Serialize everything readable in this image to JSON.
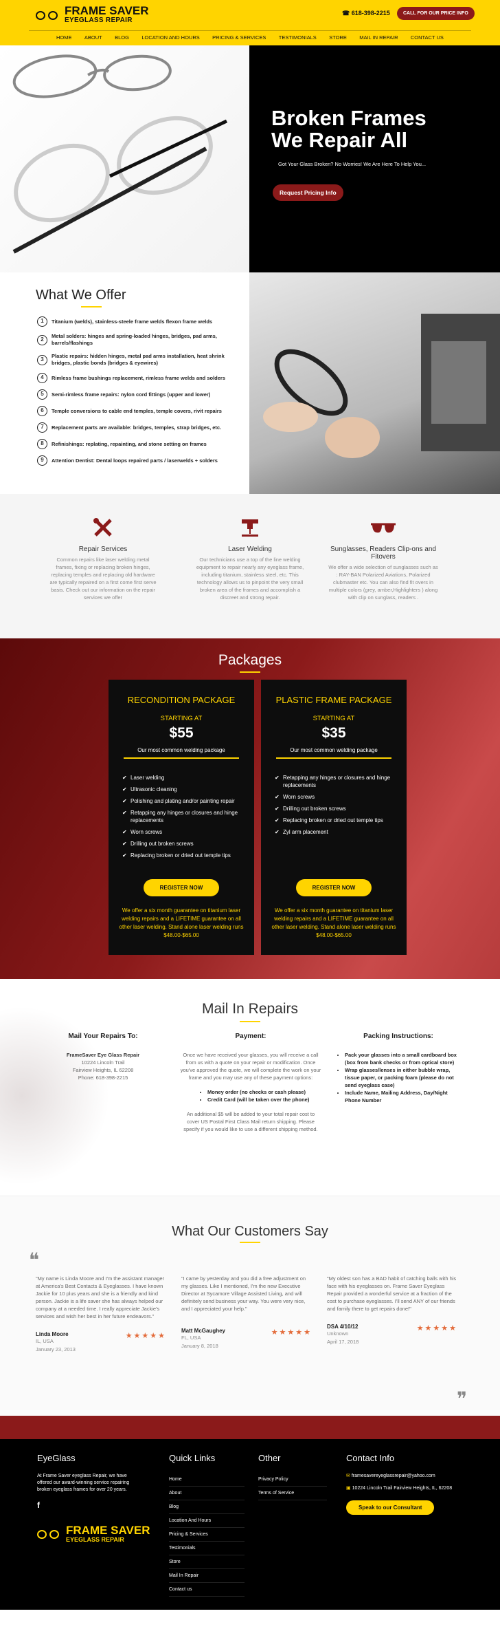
{
  "header": {
    "logo_title": "FRAME SAVER",
    "logo_sub": "EYEGLASS REPAIR",
    "phone": "618-398-2215",
    "cta": "CALL FOR OUR PRICE INFO",
    "nav": [
      "HOME",
      "ABOUT",
      "BLOG",
      "LOCATION AND HOURS",
      "PRICING & SERVICES",
      "TESTIMONIALS",
      "STORE",
      "MAIL IN REPAIR",
      "CONTACT US"
    ]
  },
  "hero": {
    "title_line1": "Broken Frames",
    "title_line2": "We Repair All",
    "subtitle": "Got Your Glass Broken? No Worries! We Are Here To Help You...",
    "button": "Request Pricing Info"
  },
  "offer": {
    "title": "What We Offer",
    "items": [
      "Titanium (welds), stainless-steele frame welds flexon frame welds",
      "Metal solders: hinges and spring-loaded hinges, bridges, pad arms, barrels/flashings",
      "Plastic repairs: hidden hinges, metal pad arms installation, heat shrink bridges, plastic bonds (bridges & eyewires)",
      "Rimless frame bushings replacement, rimless frame welds and solders",
      "Semi-rimless frame repairs: nylon cord fittings (upper and lower)",
      "Temple conversions to cable end temples, temple covers, rivit repairs",
      "Replacement parts are available: bridges, temples, strap bridges, etc.",
      "Refinishings: replating, repainting, and stone setting on frames",
      "Attention Dentist: Dental loops repaired parts / laserwelds + solders"
    ]
  },
  "services": [
    {
      "icon": "tools-icon",
      "title": "Repair Services",
      "text": "Common repairs like laser welding metal frames, fixing or replacing broken hinges, replacing temples and replacing old hardware are typically repaired on a first come first serve basis. Check out our information on the repair services we offer"
    },
    {
      "icon": "laser-icon",
      "title": "Laser Welding",
      "text": "Our technicians use a top of the line welding equipment to repair nearly any eyeglass frame, including titanium, stainless steel, etc. This technology allows us to pinpoint the very small broken area of the frames and accomplish a discreet and strong repair."
    },
    {
      "icon": "sunglasses-icon",
      "title": "Sunglasses, Readers Clip-ons and Fitovers",
      "text": "We offer a wide selection of sunglasses such as : RAY-BAN Polarized Aviations, Polarized clubmaster etc. You can also find fit overs in multiple colors (grey, amber,Highlighters ) along with clip on sunglass, readers ."
    }
  ],
  "packages": {
    "title": "Packages",
    "cards": [
      {
        "name": "RECONDITION PACKAGE",
        "starting": "STARTING AT",
        "price": "$55",
        "desc": "Our most common welding package",
        "features": [
          "Laser welding",
          "Ultrasonic cleaning",
          "Polishing and plating and/or painting repair",
          "Retapping any hinges or closures and hinge replacements",
          "Worn screws",
          "Drilling out broken screws",
          "Replacing broken or dried out temple tips"
        ],
        "button": "REGISTER NOW",
        "note": "We offer a six month guarantee on titanium laser welding repairs and a LIFETIME guarantee on all other laser welding. Stand alone laser welding runs $48.00-$65.00"
      },
      {
        "name": "PLASTIC FRAME PACKAGE",
        "starting": "STARTING AT",
        "price": "$35",
        "desc": "Our most common welding package",
        "features": [
          "Retapping any hinges or closures and hinge replacements",
          "Worn screws",
          "Drilling out broken screws",
          "Replacing broken or dried out temple tips",
          "Zyl arm placement"
        ],
        "button": "REGISTER NOW",
        "note": "We offer a six month guarantee on titanium laser welding repairs and a LIFETIME guarantee on all other laser welding. Stand alone laser welding runs $48.00-$65.00"
      }
    ]
  },
  "mail": {
    "title": "Mail In Repairs",
    "col1_title": "Mail Your Repairs To:",
    "col1_name": "FrameSaver Eye Glass Repair",
    "col1_addr1": "10224 Lincoln Trail",
    "col1_addr2": "Fairview Heights, IL 62208",
    "col1_phone": "Phone: 618-398-2215",
    "col2_title": "Payment:",
    "col2_text": "Once we have received your glasses, you will receive a call from us with a quote on your repair or modification. Once you've approved the quote, we will complete the work on your frame and you may use any of these payment options:",
    "col2_opt1": "Money order (no checks or cash please)",
    "col2_opt2": "Credit Card (will be taken over the phone)",
    "col2_text2": "An additional $5 will be added to your total repair cost to cover US Postal First Class Mail return shipping. Please specify if you would like to use a different shipping method.",
    "col3_title": "Packing Instructions:",
    "col3_items": [
      "Pack your glasses into a small cardboard box (box from bank checks or from optical store)",
      "Wrap glasses/lenses in either bubble wrap, tissue paper, or packing foam (please do not send eyeglass case)",
      "Include Name, Mailing Address, Day/Night Phone Number"
    ]
  },
  "testimonials": {
    "title": "What Our Customers Say",
    "items": [
      {
        "text": "\"My name is Linda Moore and I'm the assistant manager at America's Best Contacts & Eyeglasses. I have known Jackie for 10 plus years and she is a friendly and kind person. Jackie is a life saver she has always helped our company at a needed time. I really appreciate Jackie's services and wish her best in her future endeavors.\"",
        "name": "Linda Moore",
        "loc": "IL, USA",
        "date": "January 23, 2013"
      },
      {
        "text": "\"I came by yesterday and you did a free adjustment on my glasses. Like I mentioned, I'm the new Executive Director at Sycamore Village Assisted Living, and will definitely send business your way. You were very nice, and I appreciated your help.\"",
        "name": "Matt McGaughey",
        "loc": "FL, USA",
        "date": "January 8, 2018"
      },
      {
        "text": "\"My oldest son has a BAD habit of catching balls with his face with his eyeglasses on. Frame Saver Eyeglass Repair provided a wonderful service at a fraction of the cost to purchase eyeglasses. I'll send ANY of our friends and family there to get repairs done!\"",
        "name": "DSA 4/10/12",
        "loc": "Unknown",
        "date": "April 17, 2018"
      }
    ]
  },
  "footer": {
    "about_title": "EyeGlass",
    "about_text": "At Frame Saver eyeglass Repair, we have offered our award-winning service repairing broken eyeglass frames for over 20 years.",
    "logo_title": "FRAME SAVER",
    "logo_sub": "EYEGLASS REPAIR",
    "quick_title": "Quick Links",
    "quick_links": [
      "Home",
      "About",
      "Blog",
      "Location And Hours",
      "Pricing & Services",
      "Testimonials",
      "Store",
      "Mail In Repair",
      "Contact us"
    ],
    "other_title": "Other",
    "other_links": [
      "Privacy Policy",
      "Terms of Service"
    ],
    "contact_title": "Contact Info",
    "email": "framesavereyeglassrepair@yahoo.com",
    "address": "10224 Lincoln Trail Fairview Heights, IL, 62208",
    "button": "Speak to our Consultant"
  },
  "colors": {
    "accent": "#ffd400",
    "brand": "#8b1a1a",
    "dark": "#000000"
  }
}
